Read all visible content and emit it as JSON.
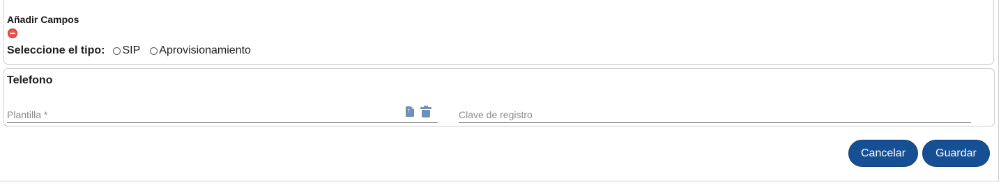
{
  "add_fields": {
    "title": "Añadir Campos",
    "remove_icon": "minus-circle-icon"
  },
  "type_selector": {
    "label": "Seleccione el tipo:",
    "options": [
      "SIP",
      "Aprovisionamiento"
    ],
    "selected": null
  },
  "phone_section": {
    "title": "Telefono",
    "template_field": {
      "placeholder": "Plantilla *",
      "value": "",
      "icons": [
        "upload-file-icon",
        "trash-icon"
      ]
    },
    "registration_key_field": {
      "placeholder": "Clave de registro",
      "value": ""
    }
  },
  "actions": {
    "cancel_label": "Cancelar",
    "save_label": "Guardar"
  },
  "colors": {
    "primary_button": "#164f94",
    "icon_blue": "#6f8fb8",
    "remove_red": "#e5554f"
  }
}
